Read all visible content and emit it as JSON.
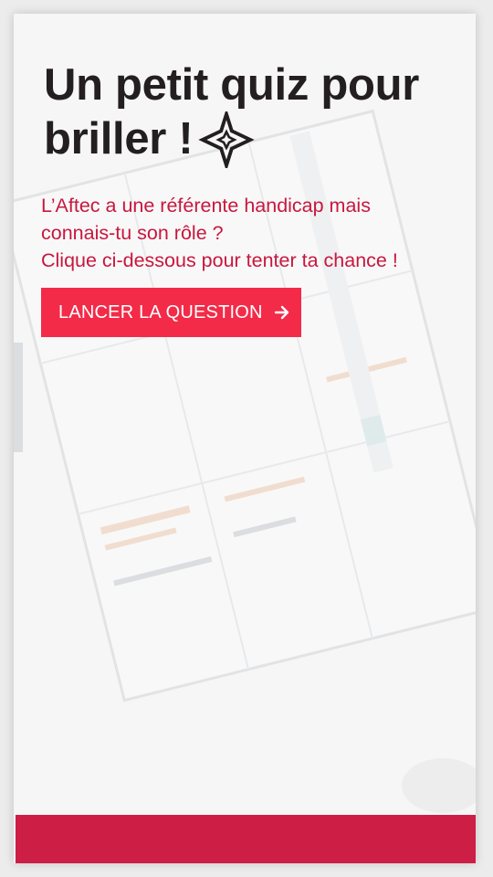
{
  "quiz": {
    "title": "Un petit quiz pour briller !",
    "title_icon": "sparkle-diamond-icon",
    "subtitle_lines": [
      "L’Aftec a une référente handicap mais",
      "connais-tu son rôle ?",
      "Clique ci-dessous pour tenter ta chance !"
    ],
    "cta_label": "LANCER LA QUESTION",
    "cta_icon": "arrow-right-icon"
  },
  "colors": {
    "title": "#231f20",
    "subtitle": "#c8173e",
    "cta_background": "#f32b48",
    "footer_band": "#cd1e45",
    "card_background": "#f6f6f6"
  }
}
